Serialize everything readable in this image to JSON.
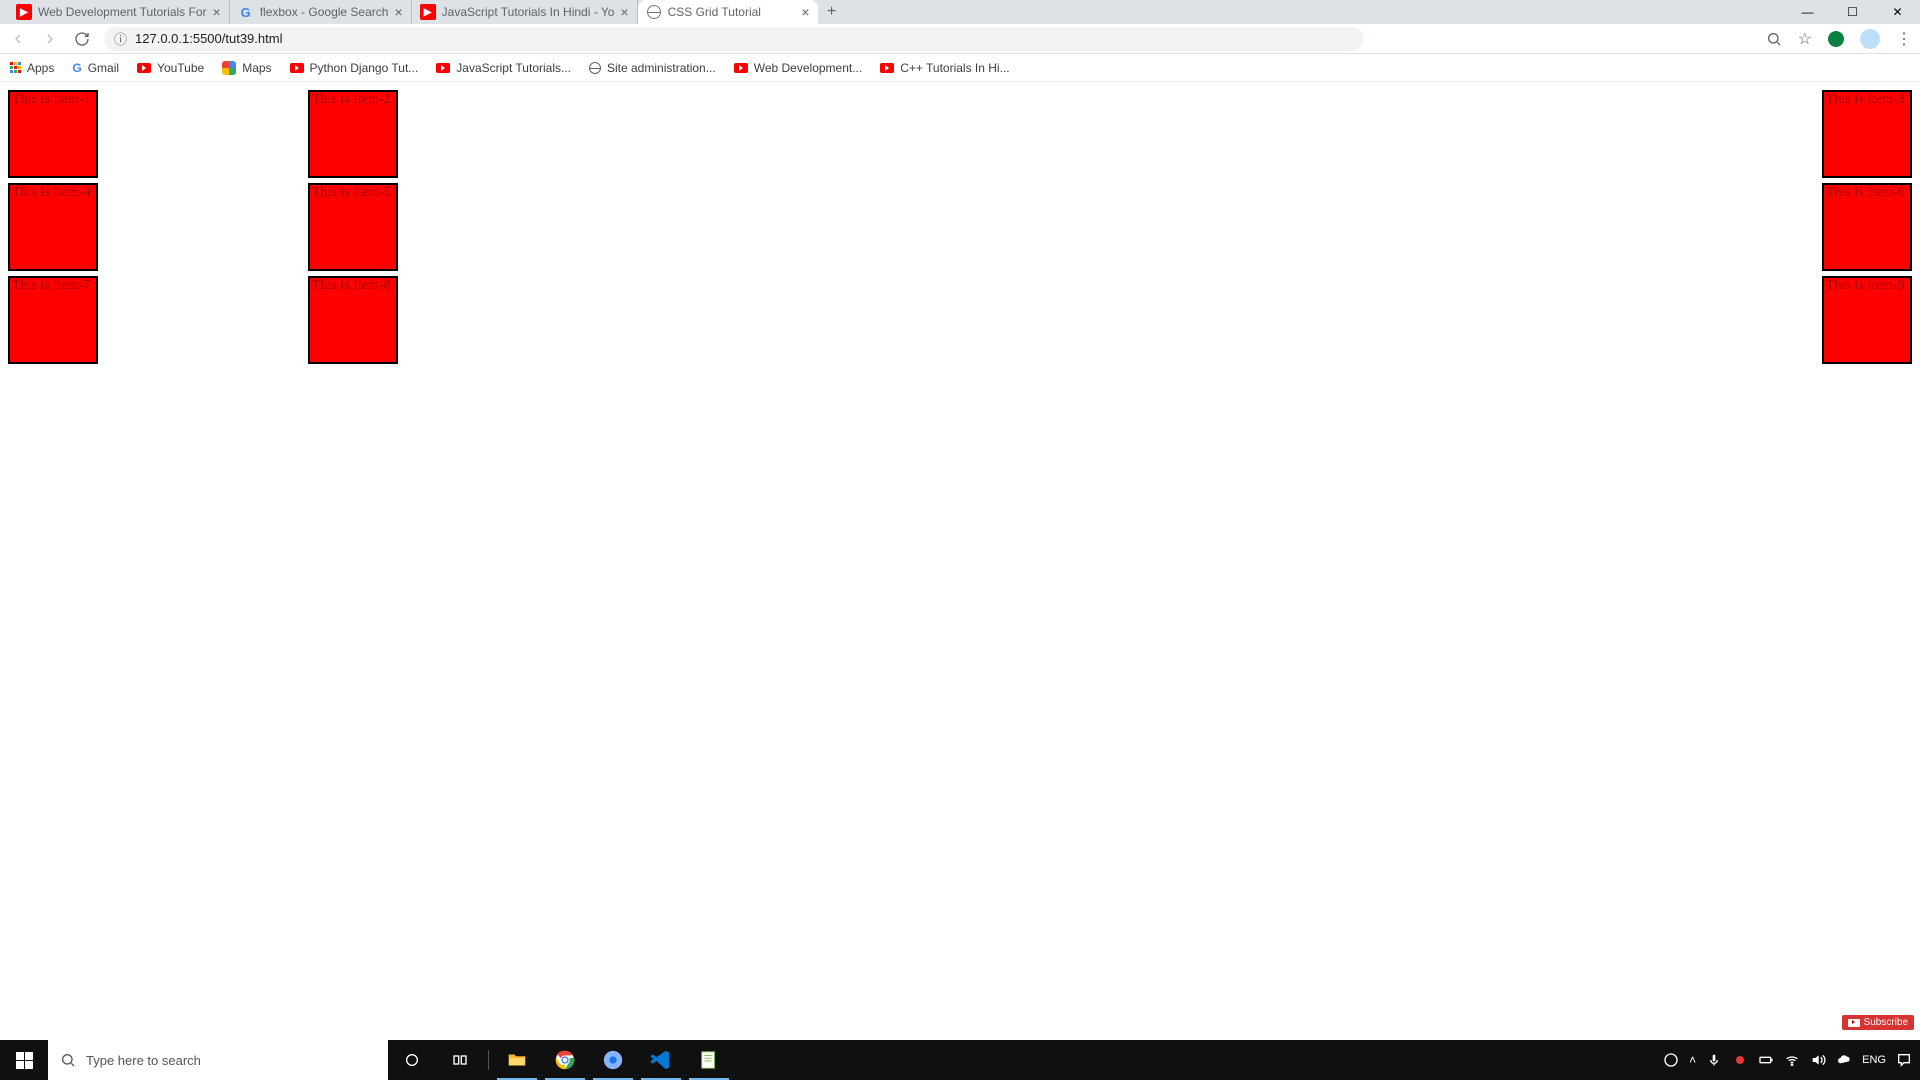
{
  "tabs": [
    {
      "title": "Web Development Tutorials For",
      "favicon": "yt"
    },
    {
      "title": "flexbox - Google Search",
      "favicon": "g"
    },
    {
      "title": "JavaScript Tutorials In Hindi - Yo",
      "favicon": "yt"
    },
    {
      "title": "CSS Grid Tutorial",
      "favicon": "globe",
      "active": true
    }
  ],
  "omnibox": {
    "url": "127.0.0.1:5500/tut39.html"
  },
  "bookmarks": [
    {
      "label": "Apps",
      "icon": "apps"
    },
    {
      "label": "Gmail",
      "icon": "g"
    },
    {
      "label": "YouTube",
      "icon": "yt"
    },
    {
      "label": "Maps",
      "icon": "maps"
    },
    {
      "label": "Python Django Tut...",
      "icon": "yt"
    },
    {
      "label": "JavaScript Tutorials...",
      "icon": "yt"
    },
    {
      "label": "Site administration...",
      "icon": "globe"
    },
    {
      "label": "Web Development...",
      "icon": "yt"
    },
    {
      "label": "C++ Tutorials In Hi...",
      "icon": "yt"
    }
  ],
  "gridItems": [
    "This is Item-1",
    "This is Item-2",
    "This is Item-3",
    "This is Item-4",
    "This is Item-5",
    "This is Item-6",
    "This is Item-7",
    "This is Item-8",
    "This is Item-9"
  ],
  "taskbar": {
    "searchPlaceholder": "Type here to search",
    "lang": "ENG"
  },
  "subscribe": "Subscribe"
}
